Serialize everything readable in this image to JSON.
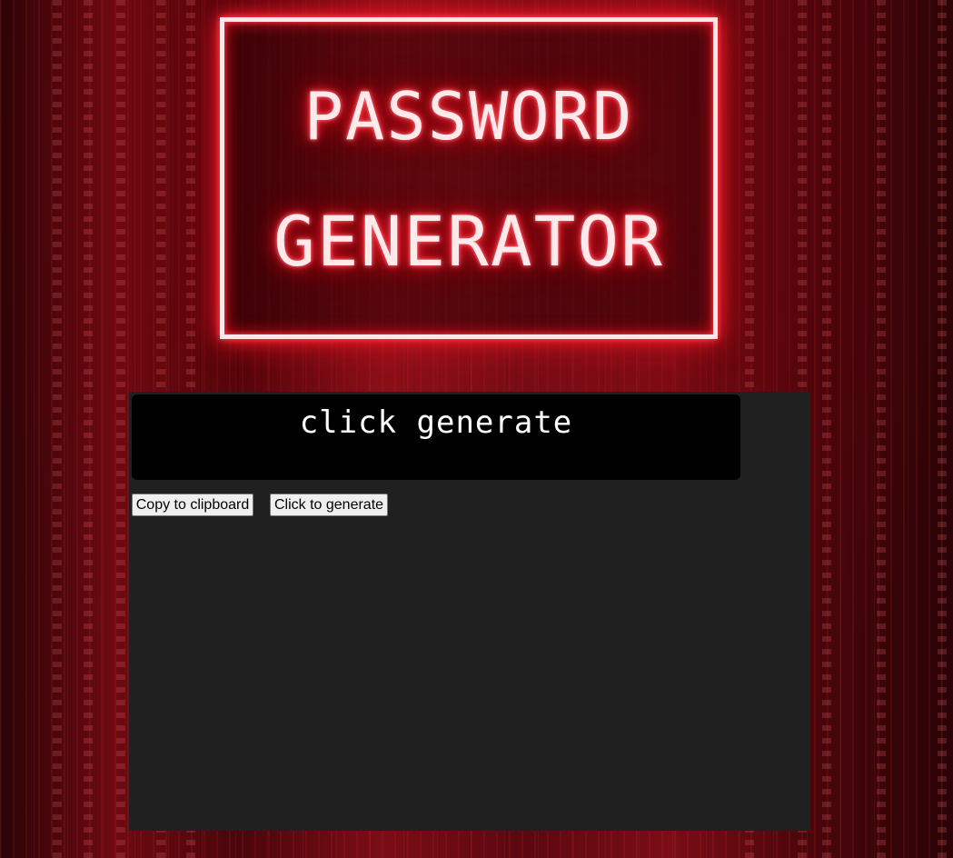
{
  "title": {
    "line1": "PASSWORD",
    "line2": "GENERATOR"
  },
  "output": {
    "text": "click generate"
  },
  "buttons": {
    "copy_label": "Copy to clipboard",
    "generate_label": "Click to generate"
  },
  "colors": {
    "neon": "#ff1e2d",
    "panel": "#202020",
    "output_bg": "#000000"
  }
}
